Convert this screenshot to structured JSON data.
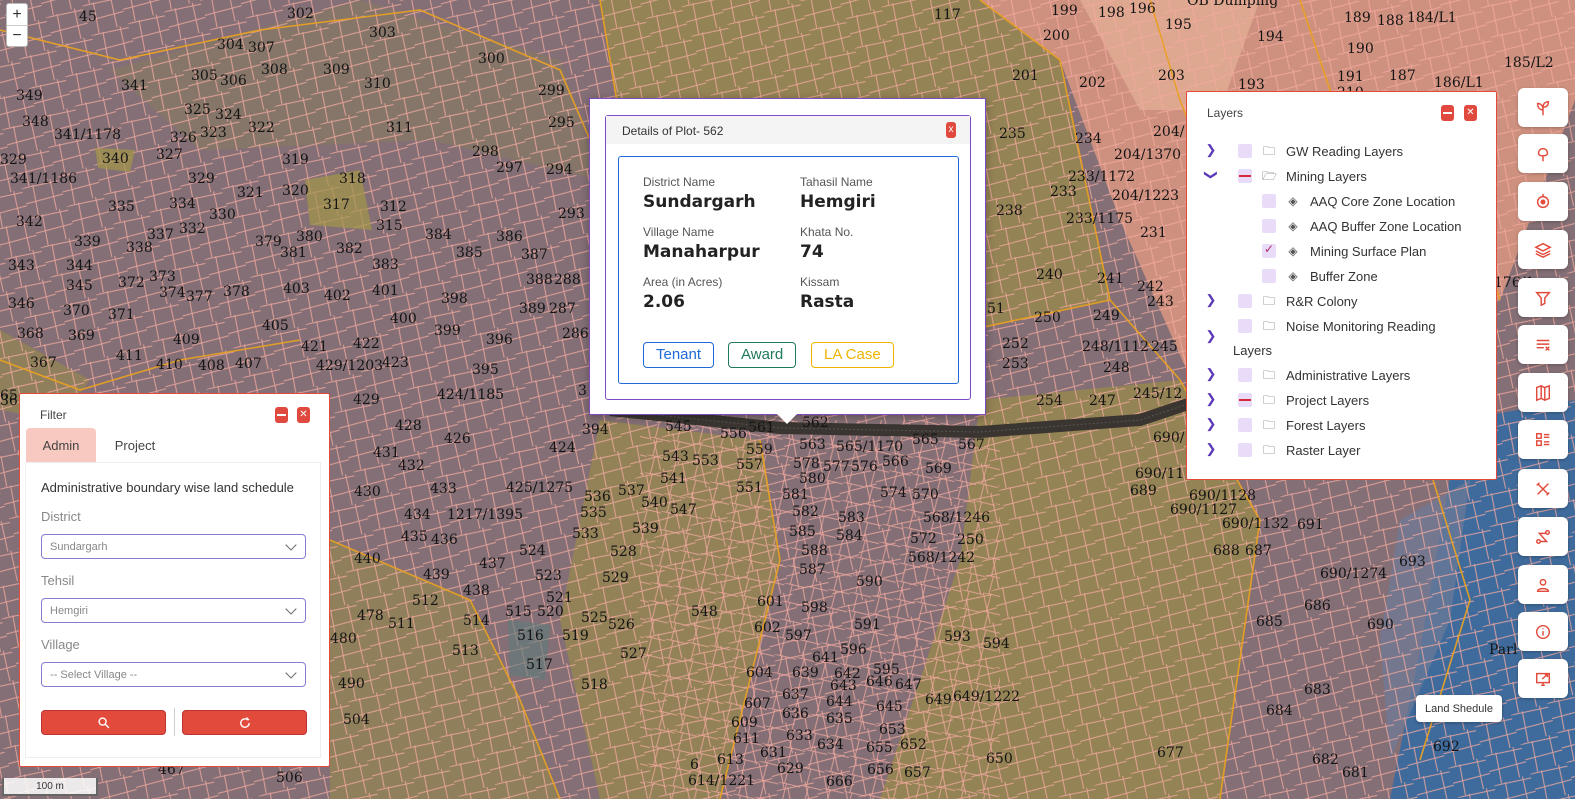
{
  "map": {
    "zoom_in": "+",
    "zoom_out": "−",
    "scale": "100 m",
    "plot_labels": [
      [
        "45",
        79,
        10
      ],
      [
        "302",
        287,
        7
      ],
      [
        "303",
        369,
        26
      ],
      [
        "300",
        478,
        52
      ],
      [
        "304",
        217,
        38
      ],
      [
        "307",
        248,
        41
      ],
      [
        "305",
        191,
        69
      ],
      [
        "306",
        220,
        74
      ],
      [
        "308",
        261,
        63
      ],
      [
        "309",
        323,
        63
      ],
      [
        "310",
        364,
        77
      ],
      [
        "341",
        121,
        79
      ],
      [
        "299",
        538,
        84
      ],
      [
        "349",
        16,
        89
      ],
      [
        "325",
        184,
        103
      ],
      [
        "324",
        215,
        108
      ],
      [
        "322",
        248,
        121
      ],
      [
        "295",
        548,
        116
      ],
      [
        "311",
        386,
        121
      ],
      [
        "348",
        22,
        115
      ],
      [
        "341/1178",
        54,
        128
      ],
      [
        "326",
        170,
        131
      ],
      [
        "323",
        200,
        126
      ],
      [
        "327",
        156,
        148
      ],
      [
        "329",
        0,
        153
      ],
      [
        "319",
        282,
        153
      ],
      [
        "298",
        472,
        145
      ],
      [
        "297",
        496,
        161
      ],
      [
        "294",
        546,
        163
      ],
      [
        "340",
        102,
        152
      ],
      [
        "341/1186",
        10,
        172
      ],
      [
        "329",
        188,
        172
      ],
      [
        "318",
        339,
        172
      ],
      [
        "321",
        237,
        186
      ],
      [
        "320",
        282,
        184
      ],
      [
        "335",
        108,
        200
      ],
      [
        "334",
        169,
        197
      ],
      [
        "317",
        323,
        198
      ],
      [
        "312",
        380,
        200
      ],
      [
        "293",
        558,
        207
      ],
      [
        "342",
        16,
        215
      ],
      [
        "330",
        209,
        208
      ],
      [
        "315",
        376,
        219
      ],
      [
        "384",
        425,
        228
      ],
      [
        "386",
        496,
        230
      ],
      [
        "339",
        74,
        235
      ],
      [
        "337",
        147,
        228
      ],
      [
        "332",
        179,
        222
      ],
      [
        "379",
        255,
        235
      ],
      [
        "380",
        296,
        230
      ],
      [
        "338",
        126,
        241
      ],
      [
        "382",
        336,
        242
      ],
      [
        "385",
        456,
        246
      ],
      [
        "387",
        521,
        248
      ],
      [
        "343",
        8,
        259
      ],
      [
        "344",
        66,
        259
      ],
      [
        "381",
        280,
        246
      ],
      [
        "383",
        372,
        258
      ],
      [
        "388",
        526,
        273
      ],
      [
        "288",
        554,
        273
      ],
      [
        "372",
        118,
        276
      ],
      [
        "373",
        149,
        270
      ],
      [
        "374",
        159,
        286
      ],
      [
        "377",
        186,
        290
      ],
      [
        "378",
        223,
        285
      ],
      [
        "403",
        283,
        282
      ],
      [
        "402",
        324,
        289
      ],
      [
        "401",
        372,
        284
      ],
      [
        "398",
        441,
        292
      ],
      [
        "345",
        66,
        279
      ],
      [
        "346",
        8,
        297
      ],
      [
        "389",
        519,
        302
      ],
      [
        "287",
        549,
        302
      ],
      [
        "370",
        63,
        304
      ],
      [
        "371",
        108,
        308
      ],
      [
        "400",
        390,
        312
      ],
      [
        "405",
        262,
        319
      ],
      [
        "286",
        562,
        327
      ],
      [
        "399",
        434,
        324
      ],
      [
        "396",
        486,
        333
      ],
      [
        "368",
        17,
        327
      ],
      [
        "369",
        68,
        329
      ],
      [
        "421",
        301,
        340
      ],
      [
        "422",
        353,
        337
      ],
      [
        "409",
        173,
        333
      ],
      [
        "423",
        382,
        356
      ],
      [
        "395",
        472,
        363
      ],
      [
        "411",
        116,
        349
      ],
      [
        "410",
        156,
        358
      ],
      [
        "408",
        198,
        359
      ],
      [
        "407",
        235,
        357
      ],
      [
        "429/1203",
        316,
        359
      ],
      [
        "367",
        30,
        356
      ],
      [
        "424/1185",
        437,
        388
      ],
      [
        "429",
        353,
        393
      ],
      [
        "428",
        395,
        419
      ],
      [
        "426",
        444,
        432
      ],
      [
        "394",
        582,
        423
      ],
      [
        "424",
        549,
        441
      ],
      [
        "431",
        373,
        446
      ],
      [
        "432",
        398,
        459
      ],
      [
        "430",
        354,
        485
      ],
      [
        "433",
        430,
        482
      ],
      [
        "425/1275",
        506,
        481
      ],
      [
        "536",
        584,
        490
      ],
      [
        "537",
        618,
        484
      ],
      [
        "540",
        641,
        496
      ],
      [
        "547",
        670,
        503
      ],
      [
        "535",
        580,
        506
      ],
      [
        "533",
        572,
        527
      ],
      [
        "539",
        632,
        522
      ],
      [
        "434",
        404,
        508
      ],
      [
        "1217/1395",
        447,
        508
      ],
      [
        "435",
        401,
        530
      ],
      [
        "436",
        431,
        533
      ],
      [
        "524",
        519,
        544
      ],
      [
        "528",
        610,
        545
      ],
      [
        "440",
        354,
        552
      ],
      [
        "437",
        479,
        557
      ],
      [
        "439",
        423,
        568
      ],
      [
        "438",
        463,
        584
      ],
      [
        "523",
        535,
        569
      ],
      [
        "529",
        602,
        571
      ],
      [
        "521",
        546,
        591
      ],
      [
        "512",
        412,
        594
      ],
      [
        "515",
        505,
        605
      ],
      [
        "520",
        537,
        605
      ],
      [
        "525",
        581,
        611
      ],
      [
        "514",
        463,
        614
      ],
      [
        "526",
        608,
        618
      ],
      [
        "478",
        357,
        609
      ],
      [
        "511",
        388,
        617
      ],
      [
        "516",
        517,
        629
      ],
      [
        "519",
        562,
        629
      ],
      [
        "480",
        330,
        632
      ],
      [
        "513",
        452,
        644
      ],
      [
        "527",
        620,
        647
      ],
      [
        "517",
        526,
        658
      ],
      [
        "518",
        581,
        678
      ],
      [
        "490",
        338,
        677
      ],
      [
        "504",
        343,
        713
      ],
      [
        "506",
        276,
        771
      ],
      [
        "467",
        158,
        763
      ],
      [
        "545",
        665,
        420
      ],
      [
        "556",
        720,
        427
      ],
      [
        "561",
        748,
        421
      ],
      [
        "562",
        802,
        416
      ],
      [
        "543",
        662,
        450
      ],
      [
        "553",
        692,
        454
      ],
      [
        "541",
        660,
        472
      ],
      [
        "557",
        736,
        458
      ],
      [
        "559",
        746,
        443
      ],
      [
        "563",
        799,
        438
      ],
      [
        "565/1170",
        836,
        440
      ],
      [
        "565",
        912,
        433
      ],
      [
        "567",
        958,
        438
      ],
      [
        "578",
        793,
        457
      ],
      [
        "577",
        823,
        460
      ],
      [
        "576",
        851,
        460
      ],
      [
        "566",
        882,
        455
      ],
      [
        "569",
        925,
        462
      ],
      [
        "551",
        736,
        481
      ],
      [
        "580",
        799,
        472
      ],
      [
        "581",
        782,
        488
      ],
      [
        "574",
        880,
        486
      ],
      [
        "570",
        912,
        488
      ],
      [
        "582",
        792,
        505
      ],
      [
        "583",
        838,
        511
      ],
      [
        "568/1246",
        923,
        511
      ],
      [
        "585",
        789,
        525
      ],
      [
        "584",
        836,
        529
      ],
      [
        "572",
        910,
        532
      ],
      [
        "250",
        957,
        533
      ],
      [
        "588",
        801,
        544
      ],
      [
        "568/1242",
        908,
        551
      ],
      [
        "587",
        799,
        563
      ],
      [
        "590",
        856,
        575
      ],
      [
        "548",
        691,
        605
      ],
      [
        "601",
        757,
        595
      ],
      [
        "598",
        801,
        601
      ],
      [
        "591",
        854,
        618
      ],
      [
        "602",
        754,
        621
      ],
      [
        "597",
        785,
        629
      ],
      [
        "641",
        812,
        651
      ],
      [
        "596",
        840,
        643
      ],
      [
        "593",
        944,
        630
      ],
      [
        "594",
        983,
        637
      ],
      [
        "604",
        746,
        666
      ],
      [
        "639",
        792,
        666
      ],
      [
        "642",
        834,
        667
      ],
      [
        "595",
        873,
        663
      ],
      [
        "646",
        866,
        675
      ],
      [
        "647",
        895,
        678
      ],
      [
        "643",
        830,
        679
      ],
      [
        "637",
        782,
        688
      ],
      [
        "644",
        826,
        695
      ],
      [
        "645",
        876,
        700
      ],
      [
        "649",
        925,
        693
      ],
      [
        "649/1222",
        953,
        690
      ],
      [
        "607",
        744,
        697
      ],
      [
        "636",
        782,
        707
      ],
      [
        "635",
        826,
        712
      ],
      [
        "653",
        879,
        723
      ],
      [
        "609",
        731,
        716
      ],
      [
        "633",
        786,
        729
      ],
      [
        "611",
        733,
        732
      ],
      [
        "652",
        900,
        738
      ],
      [
        "634",
        817,
        738
      ],
      [
        "655",
        866,
        741
      ],
      [
        "631",
        760,
        746
      ],
      [
        "613",
        717,
        753
      ],
      [
        "650",
        986,
        752
      ],
      [
        "629",
        777,
        762
      ],
      [
        "656",
        867,
        763
      ],
      [
        "657",
        904,
        766
      ],
      [
        "614/1221",
        688,
        774
      ],
      [
        "6",
        690,
        758
      ],
      [
        "666",
        826,
        775
      ],
      [
        "117",
        934,
        8
      ],
      [
        "199",
        1051,
        4
      ],
      [
        "198",
        1098,
        6
      ],
      [
        "196",
        1129,
        2
      ],
      [
        "195",
        1165,
        18
      ],
      [
        "200",
        1043,
        29
      ],
      [
        "194",
        1257,
        30
      ],
      [
        "189",
        1344,
        11
      ],
      [
        "188",
        1377,
        14
      ],
      [
        "184/L1",
        1407,
        11
      ],
      [
        "201",
        1012,
        69
      ],
      [
        "202",
        1079,
        76
      ],
      [
        "203",
        1158,
        69
      ],
      [
        "193",
        1238,
        78
      ],
      [
        "191",
        1337,
        70
      ],
      [
        "187",
        1389,
        69
      ],
      [
        "186/L1",
        1434,
        76
      ],
      [
        "190",
        1347,
        42
      ],
      [
        "185/L2",
        1504,
        56
      ],
      [
        "210",
        1337,
        86
      ],
      [
        "235",
        999,
        127
      ],
      [
        "234",
        1075,
        132
      ],
      [
        "204/",
        1153,
        125
      ],
      [
        "204/1370",
        1114,
        148
      ],
      [
        "233/1172",
        1068,
        170
      ],
      [
        "233",
        1050,
        185
      ],
      [
        "204/1223",
        1112,
        189
      ],
      [
        "238",
        996,
        204
      ],
      [
        "233/1175",
        1066,
        212
      ],
      [
        "231",
        1140,
        226
      ],
      [
        "240",
        1036,
        268
      ],
      [
        "241",
        1097,
        272
      ],
      [
        "242",
        1137,
        280
      ],
      [
        "243",
        1147,
        295
      ],
      [
        "250",
        1034,
        311
      ],
      [
        "249",
        1093,
        309
      ],
      [
        "51",
        987,
        302
      ],
      [
        "252",
        1002,
        337
      ],
      [
        "253",
        1002,
        357
      ],
      [
        "248/1112",
        1082,
        340
      ],
      [
        "245",
        1151,
        340
      ],
      [
        "248",
        1103,
        361
      ],
      [
        "245/12",
        1133,
        387
      ],
      [
        "254",
        1036,
        394
      ],
      [
        "247",
        1089,
        394
      ],
      [
        "690/",
        1153,
        431
      ],
      [
        "690/11",
        1135,
        467
      ],
      [
        "689",
        1130,
        484
      ],
      [
        "690/1128",
        1189,
        489
      ],
      [
        "690/1127",
        1170,
        503
      ],
      [
        "690/1132",
        1222,
        517
      ],
      [
        "691",
        1297,
        518
      ],
      [
        "688",
        1213,
        544
      ],
      [
        "687",
        1245,
        544
      ],
      [
        "690/1274",
        1320,
        567
      ],
      [
        "693",
        1399,
        555
      ],
      [
        "686",
        1304,
        599
      ],
      [
        "685",
        1256,
        615
      ],
      [
        "690",
        1367,
        618
      ],
      [
        "683",
        1304,
        683
      ],
      [
        "684",
        1266,
        704
      ],
      [
        "677",
        1157,
        746
      ],
      [
        "692",
        1433,
        740
      ],
      [
        "682",
        1312,
        753
      ],
      [
        "681",
        1342,
        766
      ],
      [
        "Parl",
        1489,
        643
      ],
      [
        "176/1",
        1494,
        276
      ],
      [
        "3",
        578,
        384
      ],
      [
        "36",
        0,
        394
      ],
      [
        "65",
        0,
        389
      ]
    ],
    "overlay_labels": [
      "OB Dumping"
    ]
  },
  "plot_popup": {
    "title": "Details of Plot- 562",
    "close": "x",
    "fields": [
      {
        "label": "District Name",
        "value": "Sundargarh"
      },
      {
        "label": "Tahasil Name",
        "value": "Hemgiri"
      },
      {
        "label": "Village Name",
        "value": "Manaharpur"
      },
      {
        "label": "Khata No.",
        "value": "74"
      },
      {
        "label": "Area (in Acres)",
        "value": "2.06"
      },
      {
        "label": "Kissam",
        "value": "Rasta"
      }
    ],
    "buttons": [
      {
        "label": "Tenant",
        "color": "#1e6ad8"
      },
      {
        "label": "Award",
        "color": "#1f7a5a"
      },
      {
        "label": "LA Case",
        "color": "#f0b400"
      }
    ]
  },
  "layers_panel": {
    "title": "Layers",
    "section_label": "Layers",
    "groups_top": [
      {
        "label": "GW Reading Layers",
        "expanded": false,
        "state": "none"
      },
      {
        "label": "Mining Layers",
        "expanded": true,
        "state": "partial",
        "children": [
          {
            "label": "AAQ Core Zone Location",
            "checked": false
          },
          {
            "label": "AAQ Buffer Zone Location",
            "checked": false
          },
          {
            "label": "Mining Surface Plan",
            "checked": true
          },
          {
            "label": "Buffer Zone",
            "checked": false
          }
        ]
      },
      {
        "label": "R&R Colony",
        "expanded": false,
        "state": "none"
      },
      {
        "label": "Noise Monitoring Reading",
        "expanded": false,
        "state": "none"
      }
    ],
    "groups_bottom": [
      {
        "label": "Administrative Layers",
        "state": "none"
      },
      {
        "label": "Project Layers",
        "state": "partial"
      },
      {
        "label": "Forest Layers",
        "state": "none"
      },
      {
        "label": "Raster Layer",
        "state": "none"
      }
    ]
  },
  "toolbar": {
    "tools": [
      "sprout-icon",
      "map-pin-icon",
      "location-target-icon",
      "layers-icon",
      "filter-icon",
      "list-clear-icon",
      "map-edit-icon",
      "list-view-icon",
      "ruler-cross-icon",
      "route-icon",
      "person-pin-icon",
      "info-icon",
      "export-screen-icon"
    ],
    "land_schedule": "Land Shedule"
  },
  "filter_panel": {
    "title": "Filter",
    "tabs": [
      "Admin",
      "Project"
    ],
    "active_tab": "Admin",
    "heading": "Administrative boundary wise land schedule",
    "district_label": "District",
    "district_value": "Sundargarh",
    "tehsil_label": "Tehsil",
    "tehsil_value": "Hemgiri",
    "village_label": "Village",
    "village_placeholder": "-- Select Village --"
  },
  "colors": {
    "accent": "#e24a3b",
    "purple": "#7c4ac2",
    "plot_boundary": "#f3a9a0",
    "mining_boundary": "#e8a024"
  }
}
